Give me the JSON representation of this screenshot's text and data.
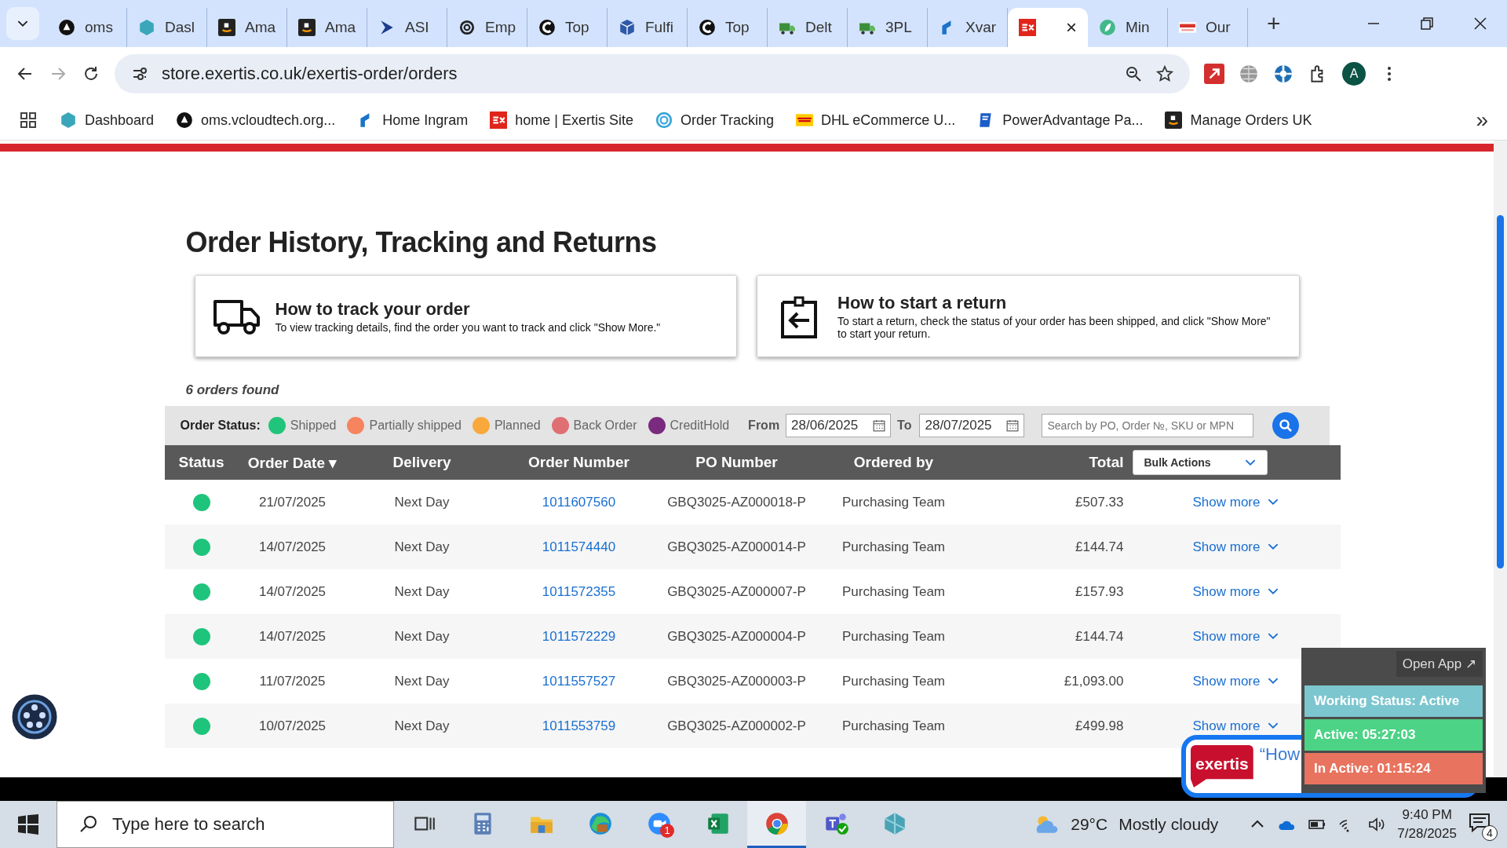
{
  "browser": {
    "tabs": [
      {
        "label": "oms",
        "selected": false
      },
      {
        "label": "Dasl",
        "selected": false
      },
      {
        "label": "Ama",
        "selected": false
      },
      {
        "label": "Ama",
        "selected": false
      },
      {
        "label": "ASI",
        "selected": false
      },
      {
        "label": "Emp",
        "selected": false
      },
      {
        "label": "Top",
        "selected": false
      },
      {
        "label": "Fulfi",
        "selected": false
      },
      {
        "label": "Top",
        "selected": false
      },
      {
        "label": "Delt",
        "selected": false
      },
      {
        "label": "3PL",
        "selected": false
      },
      {
        "label": "Xvar",
        "selected": false
      },
      {
        "close": "×",
        "selected": true
      },
      {
        "label": "Min",
        "selected": false
      },
      {
        "label": "Our",
        "selected": false
      }
    ],
    "new_tab": "+",
    "address": "store.exertis.co.uk/exertis-order/orders",
    "profile": "A",
    "bookmarks": [
      {
        "label": "Dashboard"
      },
      {
        "label": "oms.vcloudtech.org..."
      },
      {
        "label": "Home Ingram"
      },
      {
        "label": "home | Exertis Site"
      },
      {
        "label": "Order Tracking"
      },
      {
        "label": "DHL eCommerce U..."
      },
      {
        "label": "PowerAdvantage Pa..."
      },
      {
        "label": "Manage Orders UK"
      }
    ],
    "more_bookmarks": "»"
  },
  "page": {
    "title": "Order History, Tracking and Returns",
    "help_cards": [
      {
        "kind": "truck",
        "heading": "How to track your order",
        "text": "To view tracking details, find the order you want to track and click \"Show More.\""
      },
      {
        "kind": "return",
        "heading": "How to start a return",
        "text": "To start a return, check the status of your order has been shipped, and click \"Show More\" to start your return."
      }
    ],
    "orders_found": "6 orders found",
    "filter": {
      "label": "Order Status:",
      "legend": [
        {
          "label": "Shipped",
          "color": "#21c47b"
        },
        {
          "label": "Partially shipped",
          "color": "#f5845f"
        },
        {
          "label": "Planned",
          "color": "#f9a93c"
        },
        {
          "label": "Back Order",
          "color": "#e06f73"
        },
        {
          "label": "CreditHold",
          "color": "#7a2a7f"
        }
      ],
      "from_label": "From",
      "from": "28/06/2025",
      "to_label": "To",
      "to": "28/07/2025",
      "search_placeholder": "Search by PO, Order №, SKU or MPN"
    },
    "table": {
      "columns": [
        "Status",
        "Order Date ▾",
        "Delivery",
        "Order Number",
        "PO Number",
        "Ordered by",
        "Total"
      ],
      "bulk_actions": "Bulk Actions",
      "rows": [
        {
          "date": "21/07/2025",
          "delivery": "Next Day",
          "order": "1011607560",
          "po": "GBQ3025-AZ000018-P",
          "ordered_by": "Purchasing Team",
          "total": "£507.33",
          "action": "Show more"
        },
        {
          "date": "14/07/2025",
          "delivery": "Next Day",
          "order": "1011574440",
          "po": "GBQ3025-AZ000014-P",
          "ordered_by": "Purchasing Team",
          "total": "£144.74",
          "action": "Show more"
        },
        {
          "date": "14/07/2025",
          "delivery": "Next Day",
          "order": "1011572355",
          "po": "GBQ3025-AZ000007-P",
          "ordered_by": "Purchasing Team",
          "total": "£157.93",
          "action": "Show more"
        },
        {
          "date": "14/07/2025",
          "delivery": "Next Day",
          "order": "1011572229",
          "po": "GBQ3025-AZ000004-P",
          "ordered_by": "Purchasing Team",
          "total": "£144.74",
          "action": "Show more"
        },
        {
          "date": "11/07/2025",
          "delivery": "Next Day",
          "order": "1011557527",
          "po": "GBQ3025-AZ000003-P",
          "ordered_by": "Purchasing Team",
          "total": "£1,093.00",
          "action": "Show more"
        },
        {
          "date": "10/07/2025",
          "delivery": "Next Day",
          "order": "1011553759",
          "po": "GBQ3025-AZ000002-P",
          "ordered_by": "Purchasing Team",
          "total": "£499.98",
          "action": "Show more"
        }
      ]
    }
  },
  "chat": {
    "logo": "exertis",
    "text": "“How"
  },
  "tracker": {
    "open_app": "Open App ↗",
    "working_status": "Working Status: Active",
    "active": "Active: 05:27:03",
    "inactive": "In Active: 01:15:24"
  },
  "taskbar": {
    "search_placeholder": "Type here to search",
    "apps": [
      {
        "selected": false
      },
      {
        "selected": false
      },
      {
        "selected": false
      },
      {
        "selected": false,
        "badge": "1"
      },
      {
        "selected": false
      },
      {
        "selected": true
      },
      {
        "selected": false
      },
      {
        "selected": false
      }
    ],
    "temperature": "29°C",
    "weather": "Mostly cloudy",
    "time": "9:40 PM",
    "date": "7/28/2025",
    "notifications": "4"
  }
}
